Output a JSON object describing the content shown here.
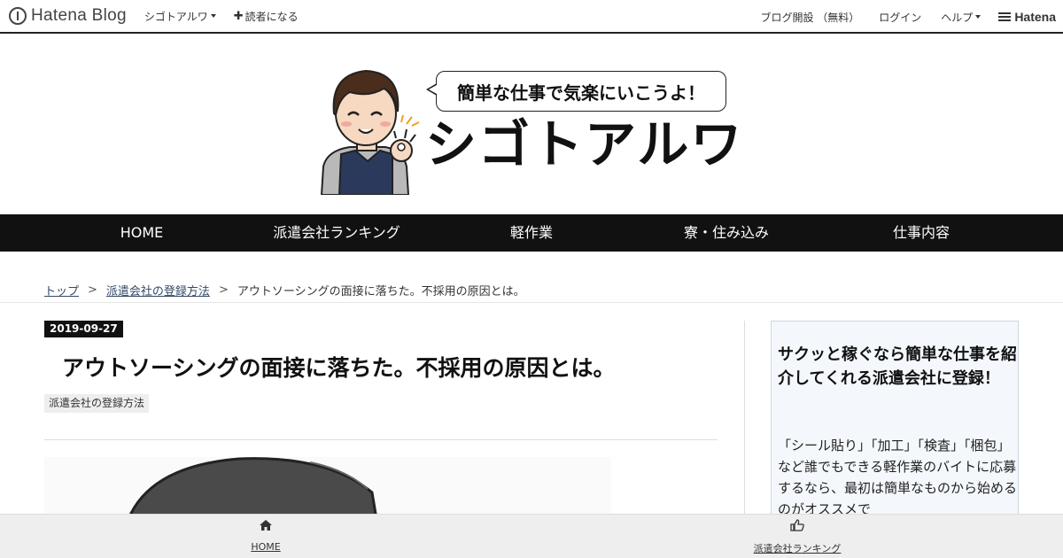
{
  "topbar": {
    "logo_text": "Hatena Blog",
    "blog_menu": "シゴトアルワ",
    "subscribe": "読者になる",
    "open_blog": "ブログ開設 （無料）",
    "login": "ログイン",
    "help": "ヘルプ",
    "hatena": "Hatena"
  },
  "header": {
    "bubble_text": "簡単な仕事で気楽にいこうよ！",
    "site_title": "シゴトアルワ"
  },
  "nav": {
    "items": [
      "HOME",
      "派遣会社ランキング",
      "軽作業",
      "寮・住み込み",
      "仕事内容"
    ]
  },
  "breadcrumb": {
    "top": "トップ",
    "category": "派遣会社の登録方法",
    "current": "アウトソーシングの面接に落ちた。不採用の原因とは。",
    "sep": ">"
  },
  "article": {
    "date": "2019-09-27",
    "title": "アウトソーシングの面接に落ちた。不採用の原因とは。",
    "category": "派遣会社の登録方法"
  },
  "sidebar": {
    "title": "サクッと稼ぐなら簡単な仕事を紹介してくれる派遣会社に登録！",
    "text": "「シール貼り」「加工」「検査」「梱包」など誰でもできる軽作業のバイトに応募するなら、最初は簡単なものから始めるのがオススメで"
  },
  "bottombar": {
    "home_label": "HOME",
    "home_icon": "home-icon",
    "ranking_label": "派遣会社ランキング",
    "ranking_icon": "thumbs-up-icon"
  },
  "colors": {
    "nav_bg": "#111111",
    "link": "#334a66",
    "sidebar_bg": "#f4f8fc"
  }
}
